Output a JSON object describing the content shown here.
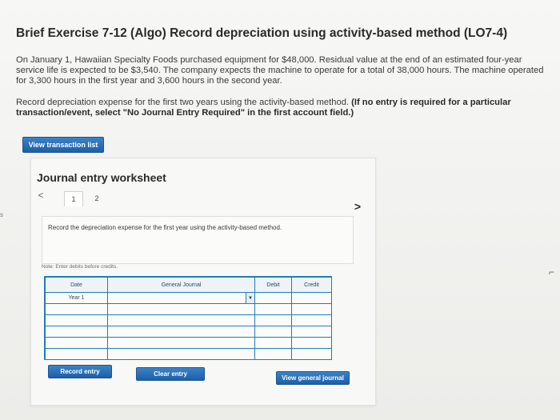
{
  "title": "Brief Exercise 7-12 (Algo) Record depreciation using activity-based method (LO7-4)",
  "intro": "On January 1, Hawaiian Specialty Foods purchased equipment for $48,000. Residual value at the end of an estimated four-year service life is expected to be $3,540. The company expects the machine to operate for a total of 38,000 hours. The machine operated for 3,300 hours in the first year and 3,600 hours in the second year.",
  "instruction_plain": "Record depreciation expense for the first two years using the activity-based method. ",
  "instruction_bold": "(If no entry is required for a particular transaction/event, select \"No Journal Entry Required\" in the first account field.)",
  "buttons": {
    "view_transaction_list": "View transaction list",
    "record_entry": "Record entry",
    "clear_entry": "Clear entry",
    "view_general_journal": "View general journal"
  },
  "worksheet": {
    "title": "Journal entry worksheet",
    "prev_icon": "<",
    "next_icon": ">",
    "tabs": [
      "1",
      "2"
    ],
    "active_tab": "1",
    "instruction": "Record the depreciation expense for the first year using the activity-based method.",
    "note": "Note: Enter debits before credits."
  },
  "journal": {
    "headers": [
      "Date",
      "General Journal",
      "Debit",
      "Credit"
    ],
    "rows": [
      {
        "date": "Year 1",
        "account": "",
        "debit": "",
        "credit": ""
      },
      {
        "date": "",
        "account": "",
        "debit": "",
        "credit": ""
      },
      {
        "date": "",
        "account": "",
        "debit": "",
        "credit": ""
      },
      {
        "date": "",
        "account": "",
        "debit": "",
        "credit": ""
      },
      {
        "date": "",
        "account": "",
        "debit": "",
        "credit": ""
      },
      {
        "date": "",
        "account": "",
        "debit": "",
        "credit": ""
      }
    ]
  },
  "edge_left_text": "s",
  "colors": {
    "button_blue": "#1e5fa6",
    "grid_border": "#1f7fb5"
  }
}
